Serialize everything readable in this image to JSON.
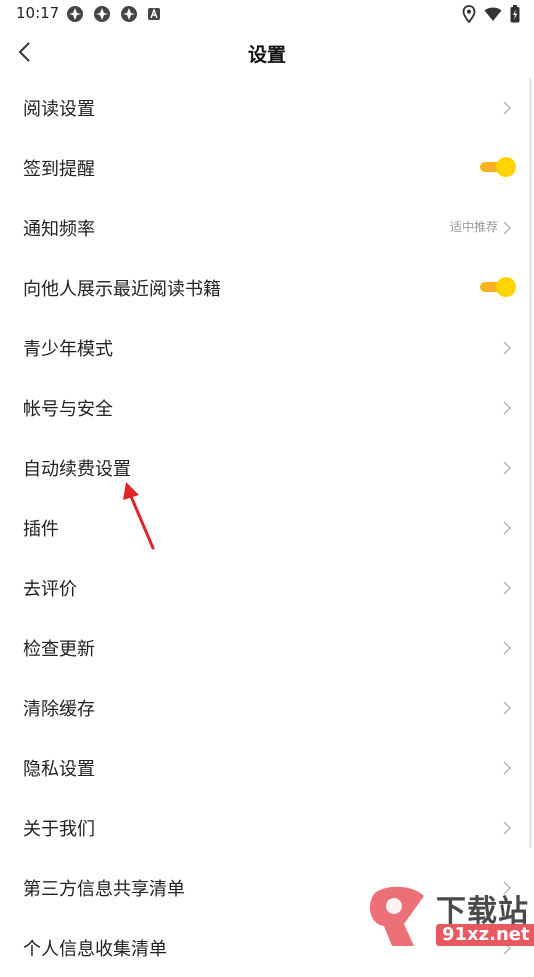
{
  "status": {
    "time": "10:17"
  },
  "header": {
    "title": "设置"
  },
  "settings": {
    "items": [
      {
        "label": "阅读设置",
        "control": "chevron"
      },
      {
        "label": "签到提醒",
        "control": "toggle",
        "on": true
      },
      {
        "label": "通知频率",
        "control": "chevron",
        "hint": "适中推荐"
      },
      {
        "label": "向他人展示最近阅读书籍",
        "control": "toggle",
        "on": true
      },
      {
        "label": "青少年模式",
        "control": "chevron"
      },
      {
        "label": "帐号与安全",
        "control": "chevron"
      },
      {
        "label": "自动续费设置",
        "control": "chevron"
      },
      {
        "label": "插件",
        "control": "chevron"
      },
      {
        "label": "去评价",
        "control": "chevron"
      },
      {
        "label": "检查更新",
        "control": "chevron"
      },
      {
        "label": "清除缓存",
        "control": "chevron"
      },
      {
        "label": "隐私设置",
        "control": "chevron"
      },
      {
        "label": "关于我们",
        "control": "chevron"
      },
      {
        "label": "第三方信息共享清单",
        "control": "chevron"
      },
      {
        "label": "个人信息收集清单",
        "control": "chevron"
      }
    ]
  },
  "watermark": {
    "title": "下载站",
    "domain": "91xz.net"
  },
  "colors": {
    "toggle_track": "#f7b11e",
    "toggle_knob": "#ffd400",
    "annotation_arrow": "#e0242a"
  },
  "icons": {
    "status_left": [
      "app-notification-icon",
      "app-notification-icon",
      "app-notification-icon",
      "a-badge-icon"
    ],
    "status_right": [
      "location-icon",
      "wifi-icon",
      "battery-charging-icon"
    ],
    "back": "back-chevron-icon"
  }
}
